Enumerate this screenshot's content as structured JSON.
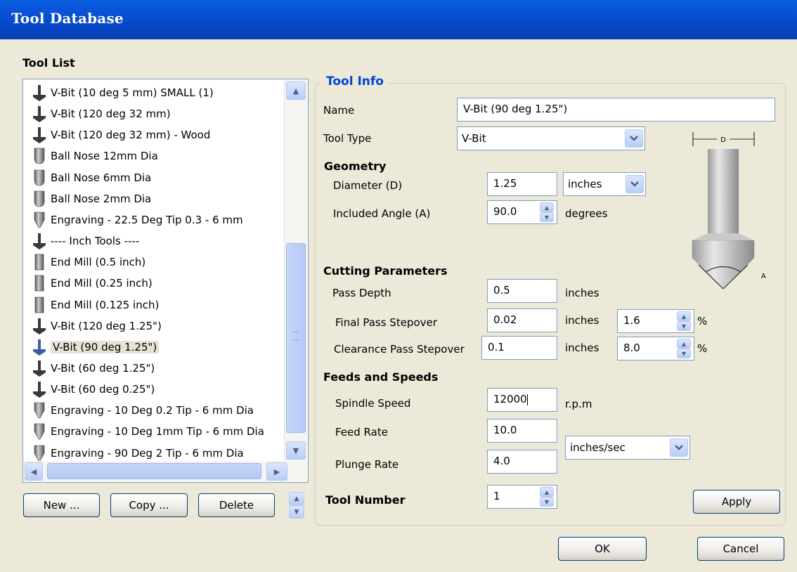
{
  "window": {
    "title": "Tool Database"
  },
  "tool_list": {
    "heading": "Tool List",
    "items": [
      {
        "label": "V-Bit (10 deg 5 mm) SMALL (1)",
        "icon": "vbit-icon"
      },
      {
        "label": "V-Bit (120 deg 32 mm)",
        "icon": "vbit-icon"
      },
      {
        "label": "V-Bit (120 deg 32 mm) - Wood",
        "icon": "vbit-icon"
      },
      {
        "label": "Ball Nose 12mm Dia",
        "icon": "ball-nose-icon"
      },
      {
        "label": "Ball Nose 6mm Dia",
        "icon": "ball-nose-icon"
      },
      {
        "label": "Ball Nose 2mm Dia",
        "icon": "ball-nose-icon"
      },
      {
        "label": "Engraving - 22.5 Deg Tip 0.3 - 6 mm",
        "icon": "engraving-icon"
      },
      {
        "label": "---- Inch Tools ----",
        "icon": "vbit-icon"
      },
      {
        "label": "End Mill (0.5 inch)",
        "icon": "end-mill-icon"
      },
      {
        "label": "End Mill (0.25 inch)",
        "icon": "end-mill-icon"
      },
      {
        "label": "End Mill (0.125 inch)",
        "icon": "end-mill-icon"
      },
      {
        "label": "V-Bit (120 deg 1.25\")",
        "icon": "vbit-icon"
      },
      {
        "label": "V-Bit (90 deg 1.25\")",
        "icon": "vbit-icon",
        "selected": true
      },
      {
        "label": "V-Bit (60 deg 1.25\")",
        "icon": "vbit-icon"
      },
      {
        "label": "V-Bit (60 deg 0.25\")",
        "icon": "vbit-icon"
      },
      {
        "label": "Engraving - 10 Deg 0.2 Tip - 6 mm Dia",
        "icon": "engraving-icon"
      },
      {
        "label": "Engraving - 10 Deg 1mm Tip - 6 mm Dia",
        "icon": "engraving-icon"
      },
      {
        "label": "Engraving - 90 Deg 2 Tip - 6 mm Dia",
        "icon": "engraving-icon"
      }
    ],
    "buttons": {
      "new": "New ...",
      "copy": "Copy ...",
      "delete": "Delete"
    }
  },
  "tool_info": {
    "heading": "Tool Info",
    "name_label": "Name",
    "name_value": "V-Bit (90 deg 1.25\")",
    "type_label": "Tool Type",
    "type_value": "V-Bit",
    "diagram": {
      "d_label": "D",
      "a_label": "A"
    }
  },
  "geometry": {
    "heading": "Geometry",
    "diameter_label": "Diameter (D)",
    "diameter_value": "1.25",
    "diameter_units": "inches",
    "angle_label": "Included Angle (A)",
    "angle_value": "90.0",
    "angle_units": "degrees"
  },
  "cutting": {
    "heading": "Cutting Parameters",
    "pass_depth_label": "Pass Depth",
    "pass_depth_value": "0.5",
    "pass_depth_units": "inches",
    "final_label": "Final Pass Stepover",
    "final_value": "0.02",
    "final_units": "inches",
    "final_percent": "1.6",
    "clearance_label": "Clearance Pass Stepover",
    "clearance_value": "0.1",
    "clearance_units": "inches",
    "clearance_percent": "8.0",
    "percent_sign": "%"
  },
  "feeds": {
    "heading": "Feeds and Speeds",
    "spindle_label": "Spindle Speed",
    "spindle_value": "12000",
    "spindle_units": "r.p.m",
    "feed_label": "Feed Rate",
    "feed_value": "10.0",
    "plunge_label": "Plunge Rate",
    "plunge_value": "4.0",
    "rate_units": "inches/sec"
  },
  "tool_number": {
    "label": "Tool Number",
    "value": "1"
  },
  "actions": {
    "apply": "Apply",
    "ok": "OK",
    "cancel": "Cancel"
  }
}
